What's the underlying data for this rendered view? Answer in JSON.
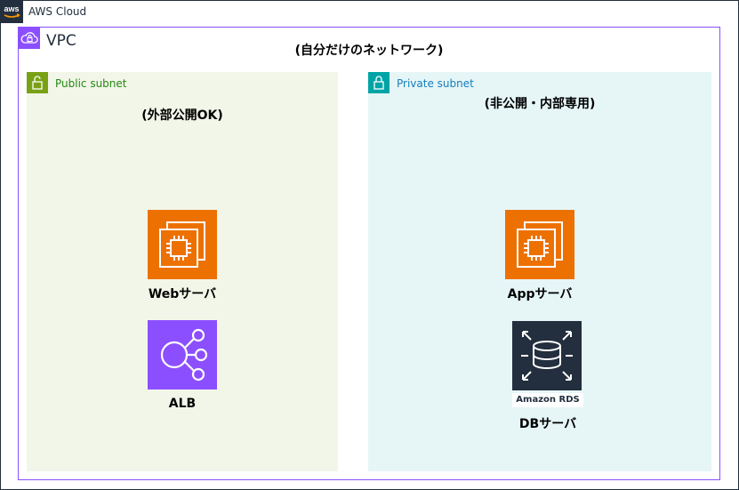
{
  "cloud": {
    "title": "AWS Cloud"
  },
  "vpc": {
    "title": "VPC",
    "note": "(自分だけのネットワーク)"
  },
  "public_subnet": {
    "title": "Public subnet",
    "note": "(外部公開OK)"
  },
  "private_subnet": {
    "title": "Private subnet",
    "note": "(非公開・内部専用)"
  },
  "nodes": {
    "web": {
      "label": "Webサーバ",
      "icon": "ec2-instance-icon"
    },
    "alb": {
      "label": "ALB",
      "icon": "elastic-load-balancing-icon"
    },
    "app": {
      "label": "Appサーバ",
      "icon": "ec2-instance-icon"
    },
    "db": {
      "label": "DBサーバ",
      "icon": "amazon-rds-icon",
      "tag": "Amazon RDS"
    }
  },
  "colors": {
    "cloud_border": "#232f3e",
    "vpc_border": "#8c4fff",
    "public_fill": "#f2f6e8",
    "public_accent": "#7aa116",
    "private_fill": "#e6f6f7",
    "private_accent": "#00a4a6",
    "compute": "#ed7100",
    "networking": "#8c4fff",
    "database": "#232f3e"
  }
}
